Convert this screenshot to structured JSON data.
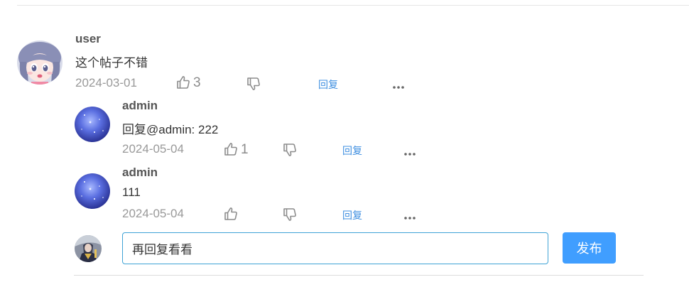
{
  "comment": {
    "username": "user",
    "content": "这个帖子不错",
    "date": "2024-03-01",
    "like_count": "3",
    "reply_label": "回复"
  },
  "replies": [
    {
      "username": "admin",
      "content": "回复@admin: 222",
      "date": "2024-05-04",
      "like_count": "1",
      "reply_label": "回复"
    },
    {
      "username": "admin",
      "content": "111",
      "date": "2024-05-04",
      "like_count": "",
      "reply_label": "回复"
    }
  ],
  "reply_box": {
    "value": "再回复看看",
    "publish_label": "发布"
  },
  "colors": {
    "accent": "#409eff",
    "input_border": "#3fa3d6",
    "link": "#3f8fe0",
    "muted": "#999999"
  },
  "icons": {
    "like": "thumbs-up-icon",
    "dislike": "thumbs-down-icon",
    "more": "more-dots-icon"
  }
}
